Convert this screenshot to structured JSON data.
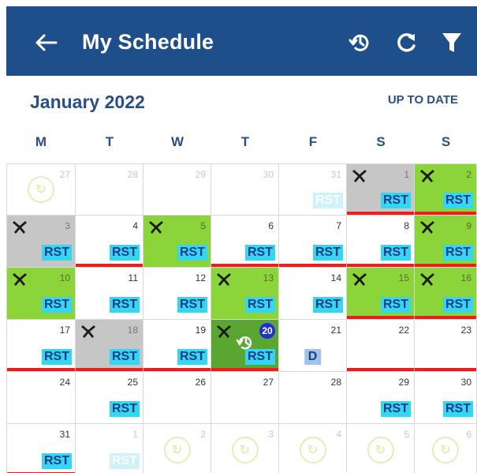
{
  "header": {
    "title": "My Schedule",
    "background": "#1f4f8a",
    "icons": [
      "back-arrow-icon",
      "history-icon",
      "refresh-icon",
      "filter-icon"
    ]
  },
  "month_label": "January 2022",
  "status": "UP TO DATE",
  "weekdays": [
    "M",
    "T",
    "W",
    "T",
    "F",
    "S",
    "S"
  ],
  "colors": {
    "rst_tag": "#35d6f0",
    "duty_tag": "#9ec4ea",
    "flight_day": "#8bd43a",
    "selected_day": "#5aa631",
    "gray_day": "#c6c6c6",
    "conflict_line": "#ef1c1c",
    "today_badge": "#1e2fd6"
  },
  "weeks": [
    [
      {
        "day": "27",
        "faded": true,
        "watermark": true
      },
      {
        "day": "28",
        "faded": true
      },
      {
        "day": "29",
        "faded": true
      },
      {
        "day": "30",
        "faded": true
      },
      {
        "day": "31",
        "faded": true,
        "tag": "RST",
        "tag_faded": true
      },
      {
        "day": "1",
        "bg": "gray",
        "plane": true,
        "tag": "RST",
        "red": true
      },
      {
        "day": "2",
        "bg": "green",
        "plane": true,
        "tag": "RST",
        "red": true
      }
    ],
    [
      {
        "day": "3",
        "bg": "gray",
        "plane": true,
        "tag": "RST"
      },
      {
        "day": "4",
        "tag": "RST",
        "red": true
      },
      {
        "day": "5",
        "bg": "green",
        "plane": true,
        "tag": "RST"
      },
      {
        "day": "6",
        "tag": "RST",
        "red": true
      },
      {
        "day": "7",
        "tag": "RST",
        "red": true
      },
      {
        "day": "8",
        "tag": "RST",
        "red": true
      },
      {
        "day": "9",
        "bg": "green",
        "plane": true,
        "tag": "RST",
        "red": true
      }
    ],
    [
      {
        "day": "10",
        "bg": "green",
        "plane": true,
        "tag": "RST"
      },
      {
        "day": "11",
        "tag": "RST"
      },
      {
        "day": "12",
        "tag": "RST"
      },
      {
        "day": "13",
        "bg": "green",
        "plane": true,
        "tag": "RST"
      },
      {
        "day": "14",
        "tag": "RST"
      },
      {
        "day": "15",
        "bg": "green",
        "plane": true,
        "tag": "RST",
        "red": true
      },
      {
        "day": "16",
        "bg": "green",
        "plane": true,
        "tag": "RST",
        "red": true
      }
    ],
    [
      {
        "day": "17",
        "tag": "RST",
        "red": true
      },
      {
        "day": "18",
        "bg": "gray",
        "plane": true,
        "tag": "RST",
        "red": true
      },
      {
        "day": "19",
        "tag": "RST",
        "red": true
      },
      {
        "day": "20",
        "bg": "dgreen",
        "plane": true,
        "tag": "RST",
        "today": true,
        "history": true,
        "red": true
      },
      {
        "day": "21",
        "tag": "D",
        "duty": true
      },
      {
        "day": "22",
        "red": true
      },
      {
        "day": "23",
        "red": true
      }
    ],
    [
      {
        "day": "24"
      },
      {
        "day": "25",
        "tag": "RST"
      },
      {
        "day": "26"
      },
      {
        "day": "27"
      },
      {
        "day": "28"
      },
      {
        "day": "29",
        "tag": "RST"
      },
      {
        "day": "30",
        "tag": "RST"
      }
    ],
    [
      {
        "day": "31",
        "tag": "RST",
        "red": true
      },
      {
        "day": "1",
        "faded": true,
        "tag": "RST",
        "tag_faded": true
      },
      {
        "day": "2",
        "faded": true,
        "watermark": true
      },
      {
        "day": "3",
        "faded": true,
        "watermark": true
      },
      {
        "day": "4",
        "faded": true,
        "watermark": true
      },
      {
        "day": "5",
        "faded": true,
        "watermark": true
      },
      {
        "day": "6",
        "faded": true,
        "watermark": true
      }
    ]
  ]
}
